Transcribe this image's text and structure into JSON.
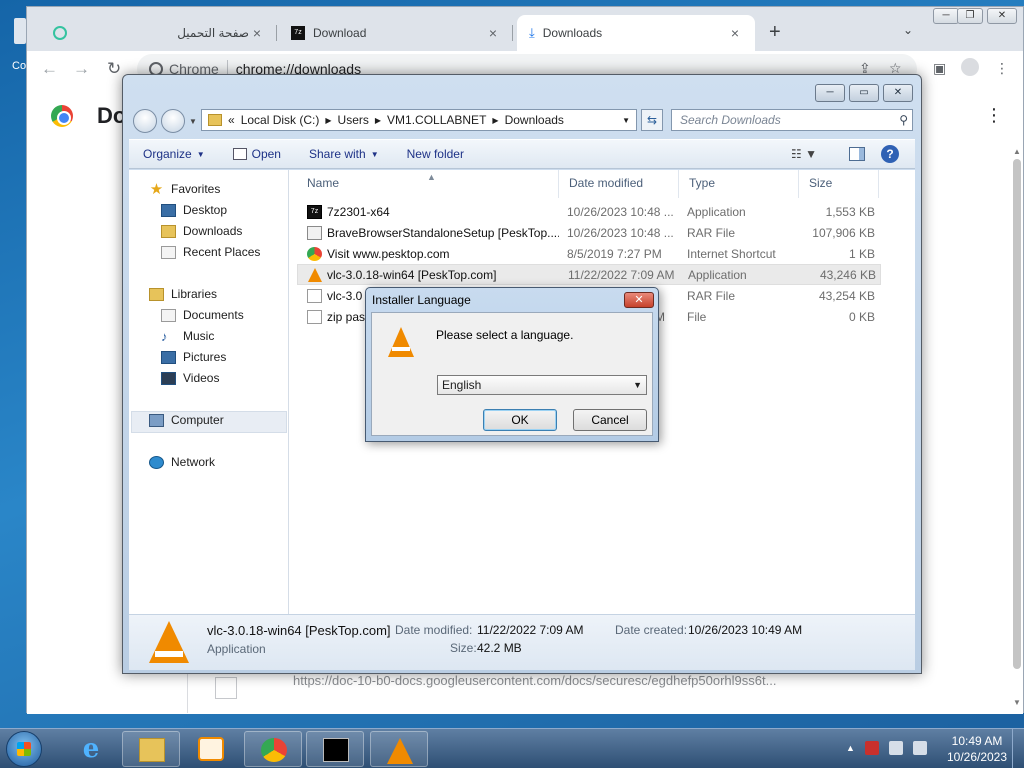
{
  "desktop": {
    "label": "Co"
  },
  "chrome": {
    "tabs": [
      {
        "label": "صفحة التحميل"
      },
      {
        "label": "Download"
      },
      {
        "label": "Downloads"
      }
    ],
    "new_tab": "+",
    "tab_menu": "⌄",
    "omnibox": {
      "site": "Chrome",
      "url": "chrome://downloads"
    },
    "page_title": "Do",
    "download_url": "https://doc-10-b0-docs.googleusercontent.com/docs/securesc/egdhefp50orhl9ss6t..."
  },
  "explorer": {
    "breadcrumb": [
      "Local Disk (C:)",
      "Users",
      "VM1.COLLABNET",
      "Downloads"
    ],
    "breadcrumb_prefix": "«",
    "search_placeholder": "Search Downloads",
    "commands": {
      "organize": "Organize",
      "open": "Open",
      "share_with": "Share with",
      "new_folder": "New folder"
    },
    "nav": {
      "favorites": "Favorites",
      "desktop": "Desktop",
      "downloads": "Downloads",
      "recent_places": "Recent Places",
      "libraries": "Libraries",
      "documents": "Documents",
      "music": "Music",
      "pictures": "Pictures",
      "videos": "Videos",
      "computer": "Computer",
      "network": "Network"
    },
    "columns": {
      "name": "Name",
      "date": "Date modified",
      "type": "Type",
      "size": "Size"
    },
    "files": [
      {
        "name": "7z2301-x64",
        "date": "10/26/2023 10:48 ...",
        "type": "Application",
        "size": "1,553 KB",
        "icon": "7z-icon"
      },
      {
        "name": "BraveBrowserStandaloneSetup [PeskTop....",
        "date": "10/26/2023 10:48 ...",
        "type": "RAR File",
        "size": "107,906 KB",
        "icon": "rar-icon"
      },
      {
        "name": "Visit www.pesktop.com",
        "date": "8/5/2019 7:27 PM",
        "type": "Internet Shortcut",
        "size": "1 KB",
        "icon": "chrome-shortcut-icon"
      },
      {
        "name": "vlc-3.0.18-win64 [PeskTop.com]",
        "date": "11/22/2022 7:09 AM",
        "type": "Application",
        "size": "43,246 KB",
        "icon": "vlc-icon"
      },
      {
        "name": "vlc-3.0",
        "date": "",
        "type": "RAR File",
        "size": "43,254 KB",
        "icon": "rar-icon"
      },
      {
        "name": "zip pas",
        "date": "M",
        "type": "File",
        "size": "0 KB",
        "icon": "file-icon"
      }
    ],
    "details": {
      "name": "vlc-3.0.18-win64 [PeskTop.com]",
      "type": "Application",
      "modified_label": "Date modified:",
      "modified_value": "11/22/2022 7:09 AM",
      "created_label": "Date created:",
      "created_value": "10/26/2023 10:49 AM",
      "size_label": "Size:",
      "size_value": "42.2 MB"
    }
  },
  "dialog": {
    "title": "Installer Language",
    "message": "Please select a language.",
    "selected_language": "English",
    "ok": "OK",
    "cancel": "Cancel"
  },
  "taskbar": {
    "clock_time": "10:49 AM",
    "clock_date": "10/26/2023",
    "tray_caret": "▲"
  }
}
